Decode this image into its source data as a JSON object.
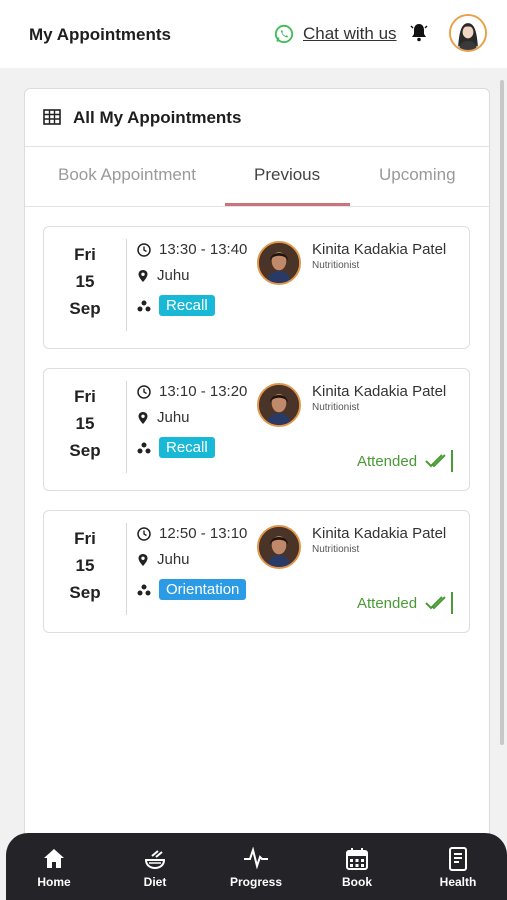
{
  "header": {
    "title": "My Appointments",
    "chat_label": "Chat with us",
    "icons": [
      "whatsapp-icon",
      "bell-icon",
      "user-avatar"
    ]
  },
  "card": {
    "title": "All My Appointments",
    "icon": "table-grid-icon"
  },
  "tabs": [
    {
      "label": "Book Appointment",
      "active": false
    },
    {
      "label": "Previous",
      "active": true
    },
    {
      "label": "Upcoming",
      "active": false
    }
  ],
  "appointments": [
    {
      "day": "Fri",
      "date": "15",
      "month": "Sep",
      "time": "13:30 - 13:40",
      "location": "Juhu",
      "type": "Recall",
      "doctor": "Kinita Kadakia Patel",
      "role": "Nutritionist",
      "status": ""
    },
    {
      "day": "Fri",
      "date": "15",
      "month": "Sep",
      "time": "13:10 - 13:20",
      "location": "Juhu",
      "type": "Recall",
      "doctor": "Kinita Kadakia Patel",
      "role": "Nutritionist",
      "status": "Attended"
    },
    {
      "day": "Fri",
      "date": "15",
      "month": "Sep",
      "time": "12:50 - 13:10",
      "location": "Juhu",
      "type": "Orientation",
      "doctor": "Kinita Kadakia Patel",
      "role": "Nutritionist",
      "status": "Attended"
    }
  ],
  "nav": [
    {
      "label": "Home",
      "icon": "home-icon"
    },
    {
      "label": "Diet",
      "icon": "diet-icon"
    },
    {
      "label": "Progress",
      "icon": "progress-icon"
    },
    {
      "label": "Book",
      "icon": "calendar-icon"
    },
    {
      "label": "Health",
      "icon": "health-icon"
    }
  ],
  "colors": {
    "recall": "#18b8d6",
    "orientation": "#2b9be6",
    "attended": "#4a9a37",
    "tab_underline": "#c9737c",
    "nav_bg": "#242428"
  }
}
